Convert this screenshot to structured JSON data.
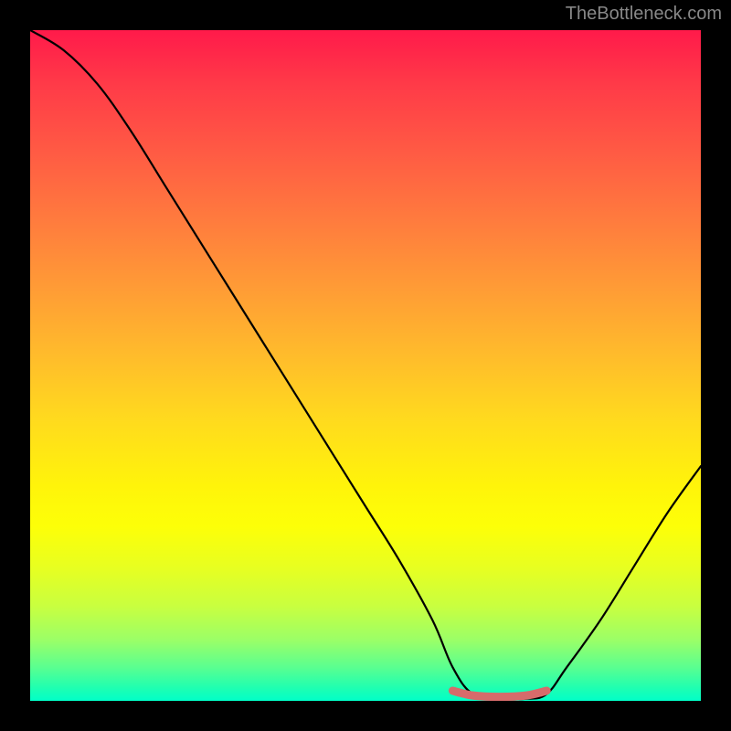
{
  "attribution": "TheBottleneck.com",
  "chart_data": {
    "type": "line",
    "title": "",
    "xlabel": "",
    "ylabel": "",
    "xlim": [
      0,
      100
    ],
    "ylim": [
      0,
      100
    ],
    "series": [
      {
        "name": "bottleneck-curve",
        "x": [
          0,
          5,
          10,
          15,
          20,
          25,
          30,
          35,
          40,
          45,
          50,
          55,
          60,
          63,
          66,
          70,
          74,
          77,
          80,
          85,
          90,
          95,
          100
        ],
        "values": [
          100,
          97,
          92,
          85,
          77,
          69,
          61,
          53,
          45,
          37,
          29,
          21,
          12,
          5,
          1,
          0.3,
          0.3,
          1,
          5,
          12,
          20,
          28,
          35
        ]
      },
      {
        "name": "optimal-range-marker",
        "x": [
          63,
          66,
          70,
          74,
          77
        ],
        "values": [
          1.5,
          0.8,
          0.6,
          0.8,
          1.5
        ]
      }
    ],
    "gradient_colors": {
      "top": "#ff1a4a",
      "mid_high": "#ff9a36",
      "mid": "#fff40a",
      "mid_low": "#c8ff40",
      "bottom": "#00ffc8"
    },
    "marker_color": "#d66b6b"
  }
}
